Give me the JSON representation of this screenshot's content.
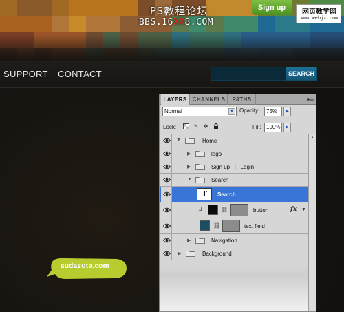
{
  "header": {
    "forum_title": "PS教程论坛",
    "forum_url_prefix": "BBS.16",
    "forum_url_highlight": "XX",
    "forum_url_suffix": "8.COM",
    "signup_label": "Sign up",
    "watermark_title": "网页教学网",
    "watermark_url": "www.webjx.com"
  },
  "nav": {
    "items": [
      "SUPPORT",
      "CONTACT"
    ],
    "search_button": "SEARCH",
    "search_value": ""
  },
  "logo": {
    "text": "sudasuta.com"
  },
  "colors": {
    "accent_blue": "#3875d7",
    "search_teal": "#1f6f96",
    "signup_green": "#5ea52c",
    "logo_lime": "#b7cc2e"
  },
  "layers_panel": {
    "tabs": [
      "LAYERS",
      "CHANNELS",
      "PATHS"
    ],
    "active_tab": "LAYERS",
    "blend_mode": "Normal",
    "opacity_label": "Opacity:",
    "opacity_value": "75%",
    "lock_label": "Lock:",
    "fill_label": "Fill:",
    "fill_value": "100%",
    "layers": [
      {
        "name": "Home",
        "kind": "group",
        "expanded": true
      },
      {
        "name": "logo",
        "kind": "group",
        "expanded": false
      },
      {
        "name": "Sign up   |   Login",
        "kind": "group",
        "expanded": false
      },
      {
        "name": "Search",
        "kind": "group",
        "expanded": true
      },
      {
        "name": "Search",
        "kind": "text",
        "selected": true
      },
      {
        "name": "button",
        "kind": "shape",
        "has_fx": true,
        "fx_label": "fx"
      },
      {
        "name": "text field",
        "kind": "shape"
      },
      {
        "name": "Navigation",
        "kind": "group",
        "expanded": false
      },
      {
        "name": "Background",
        "kind": "group",
        "expanded": false
      }
    ]
  }
}
